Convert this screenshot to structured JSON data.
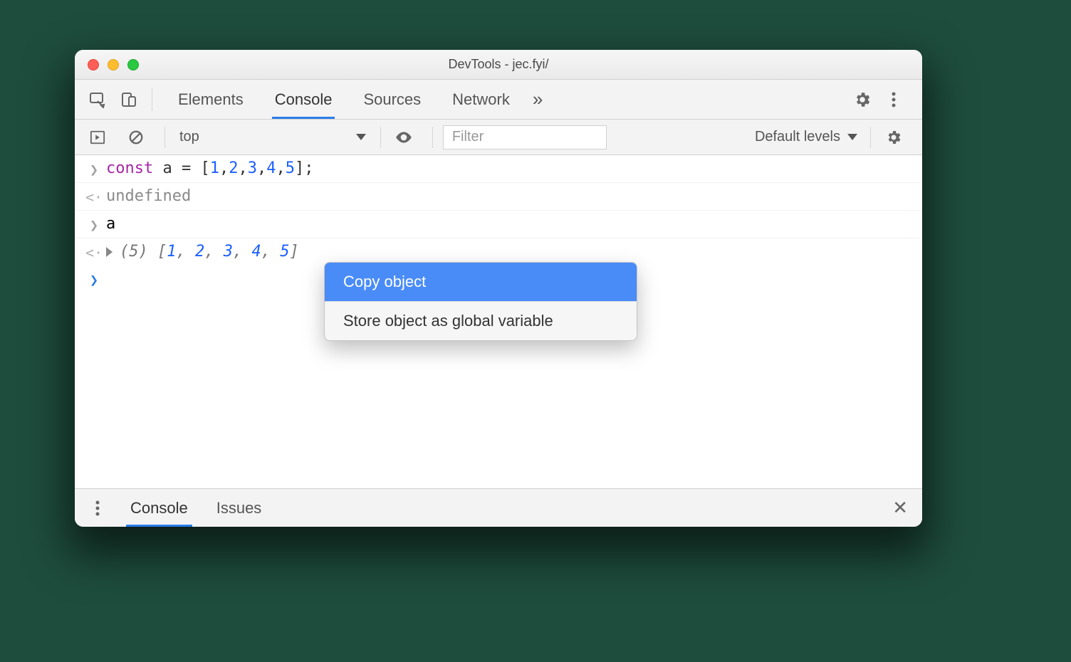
{
  "window": {
    "title": "DevTools - jec.fyi/"
  },
  "tabs": {
    "elements": "Elements",
    "console": "Console",
    "sources": "Sources",
    "network": "Network"
  },
  "console_toolbar": {
    "context": "top",
    "filter_placeholder": "Filter",
    "levels_label": "Default levels"
  },
  "log": {
    "line1_kw": "const",
    "line1_id": " a ",
    "line1_op": "= [",
    "line1_n1": "1",
    "line1_c1": ",",
    "line1_n2": "2",
    "line1_c2": ",",
    "line1_n3": "3",
    "line1_c3": ",",
    "line1_n4": "4",
    "line1_c4": ",",
    "line1_n5": "5",
    "line1_close": "];",
    "line2": "undefined",
    "line3": "a",
    "line4_len": "(5) ",
    "line4_open": "[",
    "line4_n1": "1",
    "line4_s1": ", ",
    "line4_n2": "2",
    "line4_s2": ", ",
    "line4_n3": "3",
    "line4_s3": ", ",
    "line4_n4": "4",
    "line4_s4": ", ",
    "line4_n5": "5",
    "line4_close": "]"
  },
  "context_menu": {
    "copy_object": "Copy object",
    "store_global": "Store object as global variable"
  },
  "drawer": {
    "console": "Console",
    "issues": "Issues"
  }
}
